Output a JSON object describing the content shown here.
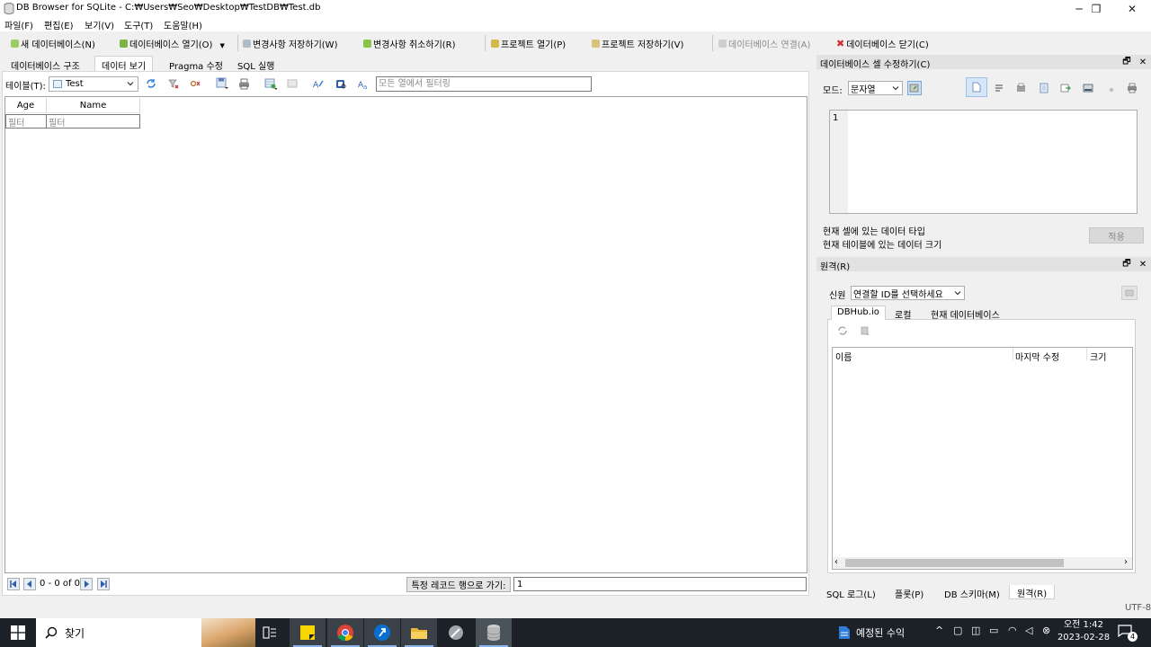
{
  "window": {
    "title": "DB Browser for SQLite - C:₩Users₩Seo₩Desktop₩TestDB₩Test.db",
    "minimize": "─",
    "maximize": "❐",
    "close": "✕"
  },
  "menu": {
    "file": "파일(F)",
    "edit": "편집(E)",
    "view": "보기(V)",
    "tools": "도구(T)",
    "help": "도움말(H)"
  },
  "toolbar": {
    "new_db": "새 데이터베이스(N)",
    "open_db": "데이터베이스 열기(O)",
    "write_changes": "변경사항 저장하기(W)",
    "revert_changes": "변경사항 취소하기(R)",
    "open_project": "프로젝트 열기(P)",
    "save_project": "프로젝트 저장하기(V)",
    "attach_db": "데이터베이스 연결(A)",
    "close_db": "데이터베이스 닫기(C)"
  },
  "tabs": [
    "데이터베이스 구조",
    "데이터 보기",
    "Pragma 수정",
    "SQL 실행"
  ],
  "browse": {
    "table_label": "테이블(T):",
    "table_selected": "Test",
    "filter_placeholder": "모든 열에서 필터링",
    "columns": [
      "Age",
      "Name"
    ],
    "column_filter_placeholder": "필터",
    "record_count": "0 - 0 of 0",
    "goto_label": "특정 레코드 행으로 가기:",
    "goto_value": "1"
  },
  "edit_cell": {
    "title": "데이터베이스 셀 수정하기(C)",
    "mode_label": "모드:",
    "mode_value": "문자열",
    "line_number": "1",
    "type_text": "현재 셀에 있는 데이터 타입",
    "size_text": "현재 테이블에 있는 데이터 크기",
    "apply": "적용",
    "float_btn": "🗗",
    "close_btn": "✕"
  },
  "remote": {
    "title": "원격(R)",
    "identity_label": "신원",
    "identity_value": "연결할 ID를 선택하세요",
    "tabs": [
      "DBHub.io",
      "로컬",
      "현재 데이터베이스"
    ],
    "columns": [
      "이름",
      "마지막 수정",
      "크기"
    ],
    "scroll_left": "‹",
    "scroll_right": "›"
  },
  "bottom_tabs": [
    "SQL 로그(L)",
    "플롯(P)",
    "DB 스키마(M)",
    "원격(R)"
  ],
  "status": {
    "encoding": "UTF-8"
  },
  "taskbar": {
    "search": "찾기",
    "weather": "예정된 수익",
    "time": "오전 1:42",
    "date": "2023-02-28",
    "notifications": "4"
  },
  "colors": {
    "accent": "#0078d7",
    "taskbar": "#1b2126",
    "chrome": "#4285f4",
    "sticky": "#f7d500",
    "folder": "#e8b73a"
  }
}
